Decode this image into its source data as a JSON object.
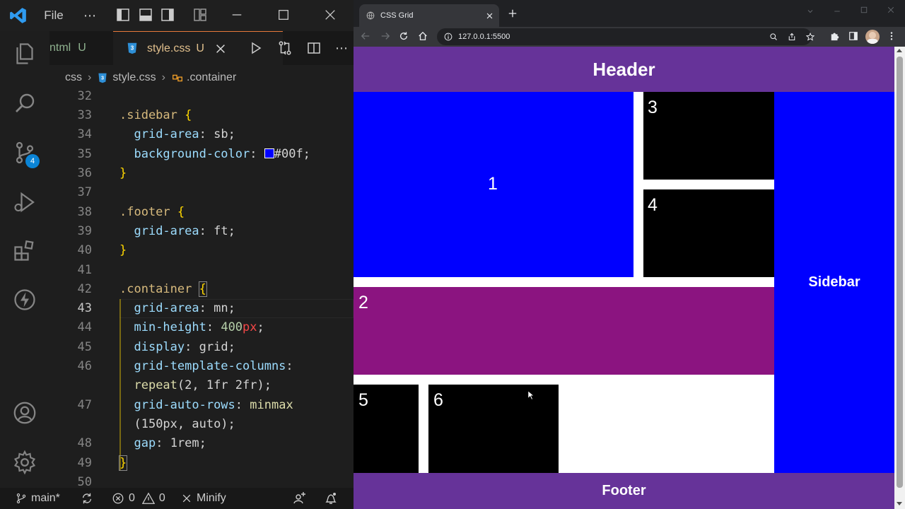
{
  "vscode": {
    "menu_file": "File",
    "tabs": [
      {
        "label": "ntml",
        "status": "U"
      },
      {
        "label": "style.css",
        "status": "U"
      }
    ],
    "breadcrumb": {
      "folder": "css",
      "file": "style.css",
      "symbol": ".container"
    },
    "scm_badge": "4",
    "lines": [
      {
        "n": "32"
      },
      {
        "n": "33"
      },
      {
        "n": "34"
      },
      {
        "n": "35"
      },
      {
        "n": "36"
      },
      {
        "n": "37"
      },
      {
        "n": "38"
      },
      {
        "n": "39"
      },
      {
        "n": "40"
      },
      {
        "n": "41"
      },
      {
        "n": "42"
      },
      {
        "n": "43"
      },
      {
        "n": "44"
      },
      {
        "n": "45"
      },
      {
        "n": "46"
      },
      {
        "n": "47"
      },
      {
        "n": "48"
      },
      {
        "n": "49"
      },
      {
        "n": "50"
      }
    ],
    "code": {
      "l33_sel": ".sidebar",
      "l33_br": "{",
      "l34_prop": "grid-area",
      "l34_val": "sb;",
      "l35_prop": "background-color",
      "l35_val": "#00f;",
      "l36_br": "}",
      "l38_sel": ".footer",
      "l38_br": "{",
      "l39_prop": "grid-area",
      "l39_val": "ft;",
      "l40_br": "}",
      "l42_sel": ".container",
      "l42_br": "{",
      "l43_prop": "grid-area",
      "l43_val": "mn;",
      "l44_prop": "min-height",
      "l44_num": "400",
      "l44_unit": "px",
      "l45_prop": "display",
      "l45_val": "grid;",
      "l46_prop": "grid-template-columns",
      "l46b_fn": "repeat",
      "l46b_args": "(2, 1fr 2fr);",
      "l47_prop": "grid-auto-rows",
      "l47_fn": "minmax",
      "l47b_args": "(150px, auto);",
      "l48_prop": "gap",
      "l48_val": "1rem;",
      "l49_br": "}"
    },
    "status": {
      "branch": "main*",
      "errors": "0",
      "warnings": "0",
      "minify": "Minify"
    }
  },
  "browser": {
    "tab_title": "CSS Grid",
    "url": "127.0.0.1:5500",
    "page": {
      "header": "Header",
      "sidebar": "Sidebar",
      "footer": "Footer",
      "cells": [
        "1",
        "2",
        "3",
        "4",
        "5",
        "6"
      ]
    }
  },
  "colors": {
    "purple": "#663399",
    "blue": "#0000ff",
    "magenta": "#8b1480",
    "black": "#000000",
    "accent_tab": "#e8793a"
  }
}
